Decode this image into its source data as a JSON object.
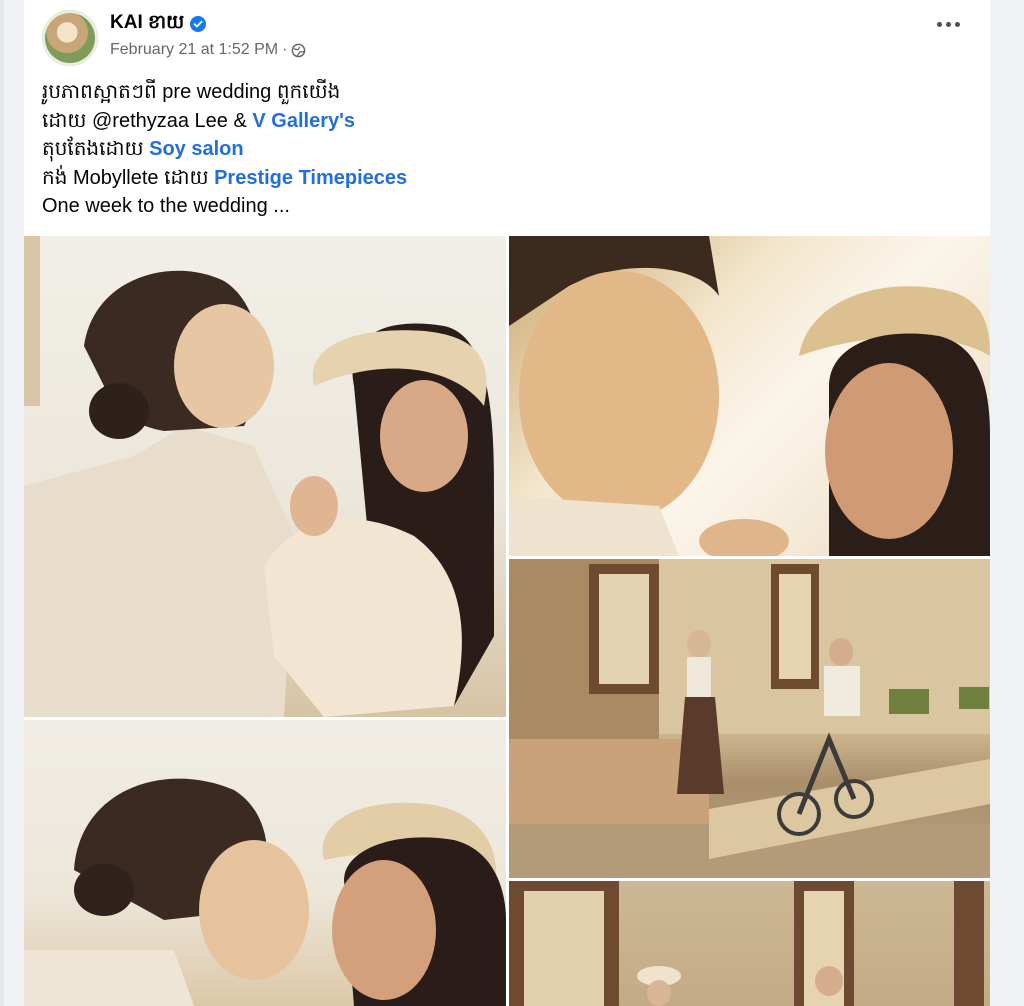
{
  "post": {
    "author": "KAI ខាយ",
    "timestamp": "February 21 at 1:52 PM",
    "separator": "·",
    "text": {
      "line1": "រូបភាពស្អាតៗពី pre wedding ពួកយើង",
      "line2_prefix": "ដោយ @rethyzaa Lee & ",
      "line2_link": "V Gallery's",
      "line3_prefix": "តុបតែងដោយ ",
      "line3_link": "Soy salon",
      "line4_prefix": " កង់ Mobyllete ដោយ ",
      "line4_link": "Prestige Timepieces",
      "line5": "One week to the wedding ..."
    }
  },
  "icons": {
    "verified": "verified-badge-icon",
    "audience": "globe-icon",
    "more": "more-options-icon"
  },
  "colors": {
    "link": "#216fdb",
    "verified": "#1877f2",
    "meta": "#65676b",
    "background": "#f0f2f5"
  }
}
